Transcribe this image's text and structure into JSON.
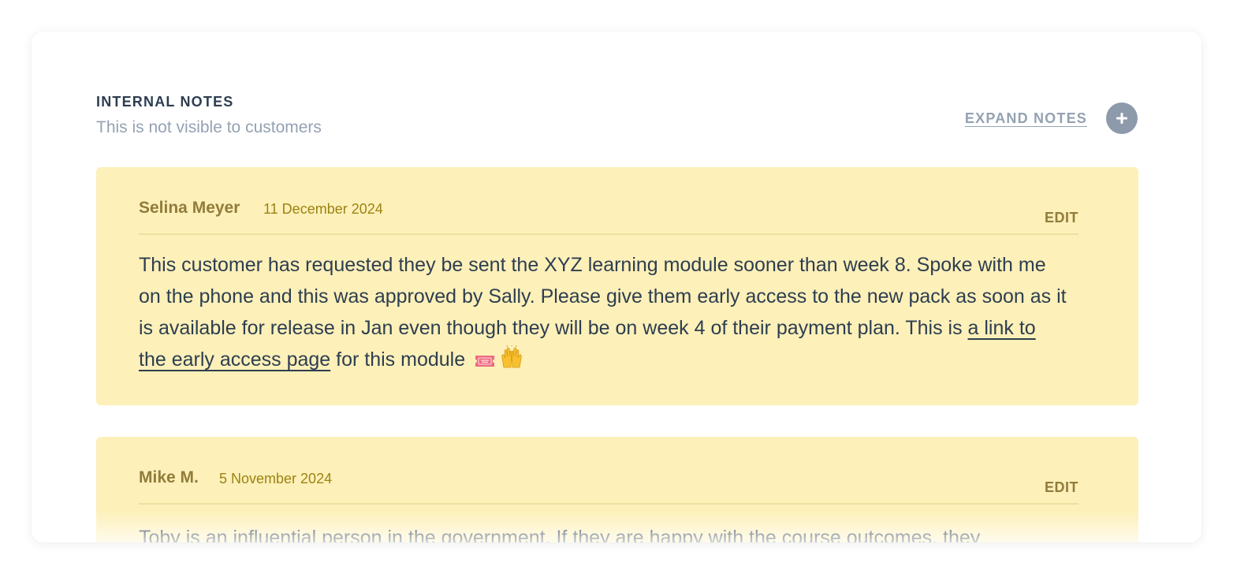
{
  "header": {
    "title": "INTERNAL NOTES",
    "subtitle": "This is not visible to customers",
    "expand_label": "EXPAND NOTES"
  },
  "notes": [
    {
      "author": "Selina Meyer",
      "date": "11 December 2024",
      "edit_label": "EDIT",
      "body_before": "This customer has requested they be sent the XYZ learning module sooner than week 8. Spoke with me on the phone and this was approved by Sally. Please give them early access to the new pack as soon as it is available for release in Jan even though they will be on week 4 of their payment plan. This is ",
      "link_text": "a link to the early access page",
      "body_after": " for this module",
      "emojis": [
        "ticket-icon",
        "raising-hands-icon"
      ]
    },
    {
      "author": "Mike M.",
      "date": "5 November 2024",
      "edit_label": "EDIT",
      "body": "Toby is an influential person in the government. If they are happy with the course outcomes, they"
    }
  ],
  "colors": {
    "note_bg": "#fdf0b9",
    "heading": "#2d3e50",
    "muted": "#94a2b2",
    "author": "#917c3a",
    "date": "#9c8312",
    "plus_button": "#8d9aab"
  }
}
